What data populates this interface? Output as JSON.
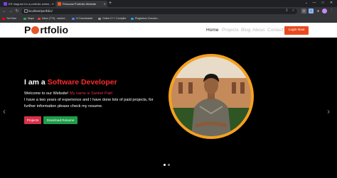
{
  "browser": {
    "tabs": [
      {
        "label": "ER diagram for a portfolio websi...",
        "icon_color": "#7b3fe4",
        "active": false
      },
      {
        "label": "Personal Portfolio Website",
        "icon_color": "#e8562a",
        "active": true
      }
    ],
    "new_tab": "+",
    "window_controls": {
      "minimize": "—",
      "maximize": "□",
      "close": "✕",
      "menu": "⌄"
    },
    "nav": {
      "back": "←",
      "forward": "→",
      "reload": "↻"
    },
    "url": "localhost/portfolio/",
    "toolbar_icons": {
      "share": "⇪",
      "star": "☆",
      "menu": "⋮"
    },
    "bookmarks": [
      {
        "label": "YouTube",
        "color": "#ff0000"
      },
      {
        "label": "Maps",
        "color": "#34a853"
      },
      {
        "label": "Inbox (774) - sanket...",
        "color": "#ea4335"
      },
      {
        "label": "IV Downloader",
        "color": "#4285f4"
      },
      {
        "label": "Online C++ Compiler",
        "color": "#999999"
      },
      {
        "label": "Plagiarism Checker...",
        "color": "#1aa3e8"
      }
    ]
  },
  "site": {
    "logo": {
      "prefix": "P",
      "suffix": "rtfolio",
      "dot_color": "#e8562a"
    },
    "nav": [
      "Home",
      "Projects",
      "Blog",
      "About",
      "Contact"
    ],
    "login": "Login Now",
    "hero": {
      "headline_prefix": "I am a ",
      "headline_highlight": "Software Developer",
      "welcome": "Welcome to our Website!",
      "name_line": "My name is Sanket Patil",
      "line2": "I have a two years of experience and I have done lots of paid projects, for",
      "line3": "further information please check my resume.",
      "projects_btn": "Projects",
      "resume_btn": "Download Resume"
    },
    "carousel": {
      "prev": "‹",
      "next": "›",
      "slides": 2,
      "active_slide": 1
    }
  }
}
